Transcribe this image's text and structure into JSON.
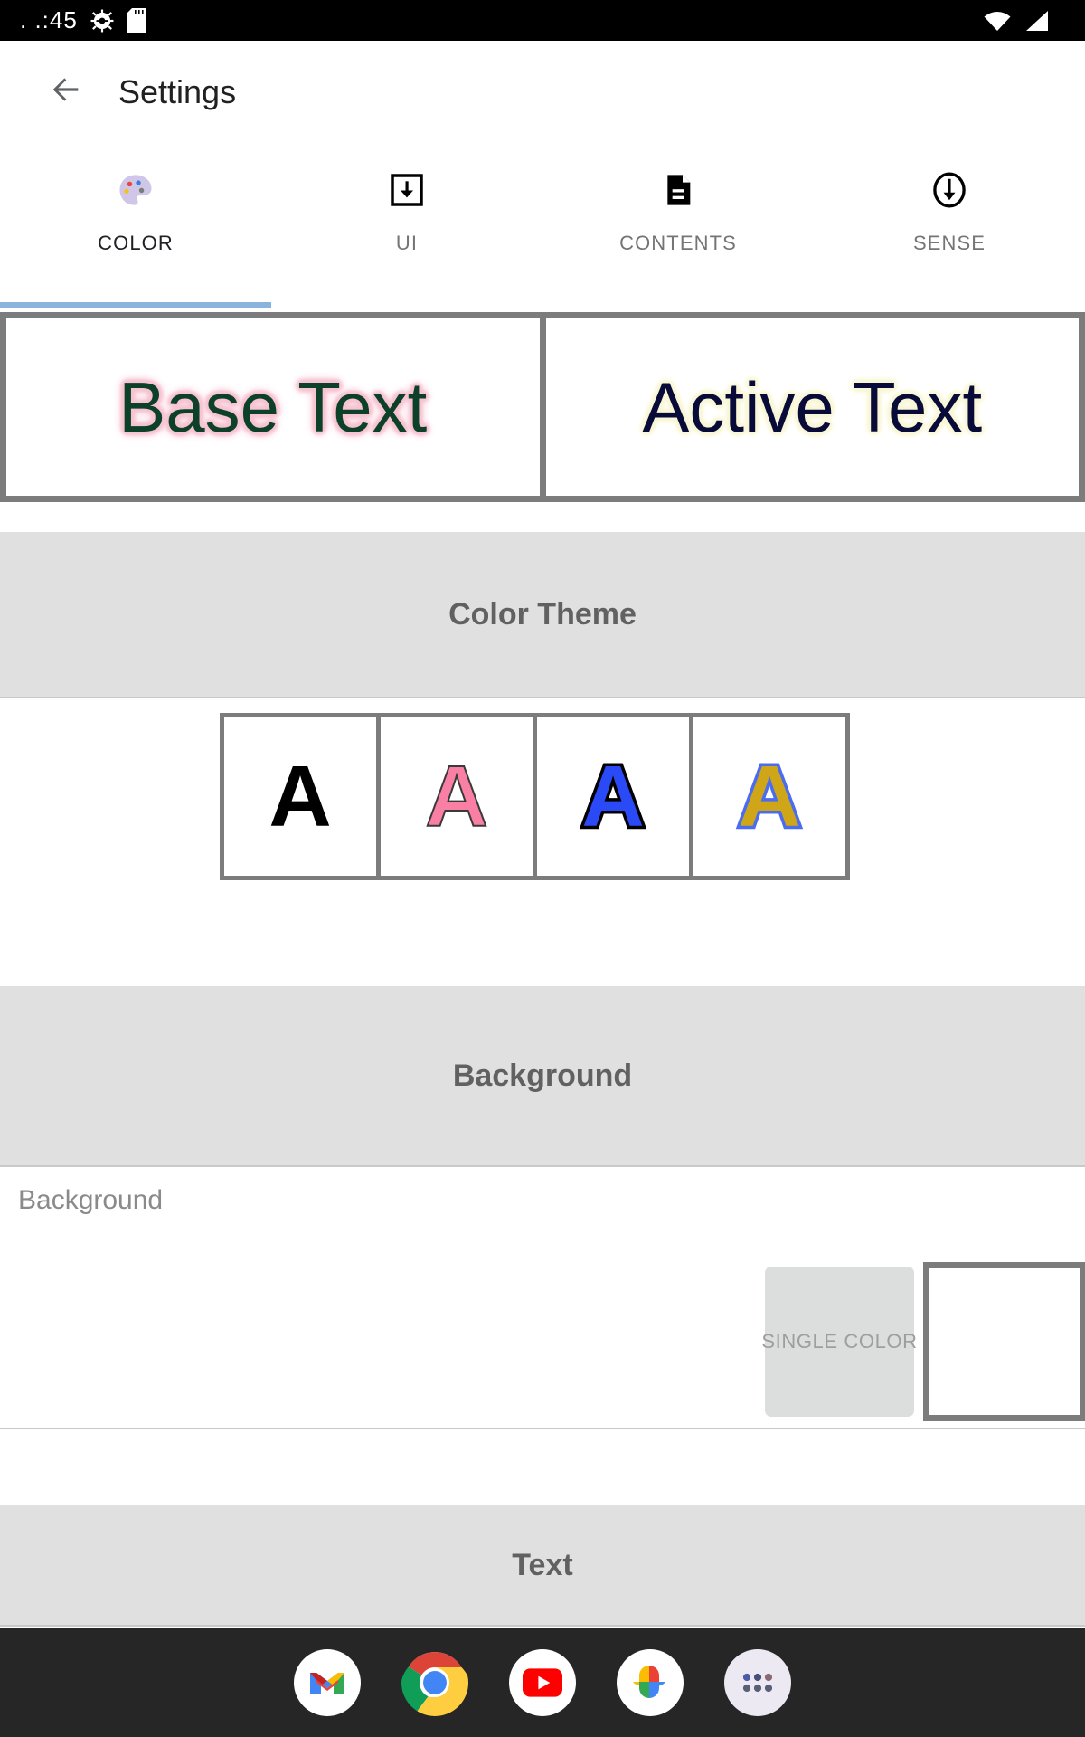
{
  "status_bar": {
    "clock": ". .:45",
    "icons": [
      "gear-icon",
      "sd-card-icon",
      "wifi-icon",
      "cellular-signal-icon"
    ]
  },
  "app_bar": {
    "back_icon": "arrow-left-icon",
    "title": "Settings"
  },
  "tabs": {
    "active_index": 0,
    "items": [
      {
        "label": "COLOR",
        "icon": "palette-icon"
      },
      {
        "label": "UI",
        "icon": "download-box-icon"
      },
      {
        "label": "CONTENTS",
        "icon": "document-icon"
      },
      {
        "label": "SENSE",
        "icon": "circle-down-arrow-icon"
      }
    ],
    "indicator_color": "#8ab4dc"
  },
  "preview": {
    "base": {
      "text": "Base Text",
      "color": "#0d4028",
      "glow_color": "#f6c3d2"
    },
    "active": {
      "text": "Active Text",
      "color": "#080a38",
      "glow_color": "#f8f6d6"
    },
    "frame_color": "#7c7c7c"
  },
  "sections": {
    "color_theme": {
      "title": "Color Theme"
    },
    "background": {
      "title": "Background"
    },
    "text": {
      "title": "Text"
    }
  },
  "color_theme": {
    "swatches": [
      {
        "letter": "A",
        "fill": "#000000",
        "stroke": "#000000"
      },
      {
        "letter": "A",
        "fill": "#f97fa4",
        "stroke": "#3a3a3a"
      },
      {
        "letter": "A",
        "fill": "#2b4af7",
        "stroke": "#000000"
      },
      {
        "letter": "A",
        "fill": "#cfa617",
        "stroke": "#4a6cf0"
      }
    ]
  },
  "background_row": {
    "label": "Background",
    "mode_button": "SINGLE COLOR",
    "swatch_color": "#ffffff",
    "swatch_border": "#7c7c7c"
  },
  "dock": {
    "apps": [
      {
        "name": "gmail-app-icon"
      },
      {
        "name": "chrome-app-icon"
      },
      {
        "name": "youtube-app-icon"
      },
      {
        "name": "google-photos-app-icon"
      },
      {
        "name": "app-drawer-icon"
      }
    ]
  }
}
